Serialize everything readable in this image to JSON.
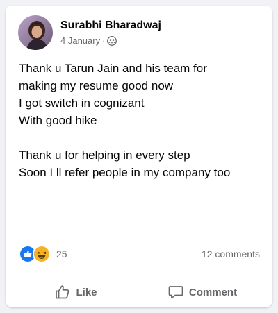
{
  "post": {
    "author": "Surabhi Bharadwaj",
    "date": "4 January",
    "separator": "·",
    "audience_icon": "friends-icon",
    "lines": [
      "Thank u Tarun Jain and his team for",
      "making my resume good now",
      "I got switch in cognizant",
      "With good hike",
      "",
      "Thank u for helping in every step",
      "Soon I ll refer people in my company too"
    ]
  },
  "stats": {
    "reaction_icons": [
      "like-icon",
      "haha-icon"
    ],
    "reaction_count": "25",
    "comments": "12 comments"
  },
  "actions": {
    "like_label": "Like",
    "comment_label": "Comment"
  },
  "colors": {
    "like_blue": "#1877f2",
    "haha_yellow": "#f7b125",
    "text_secondary": "#65676b",
    "text_primary": "#050505"
  }
}
